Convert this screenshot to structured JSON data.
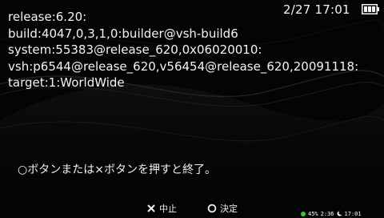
{
  "status_bar": {
    "clock": "2/27 17:01",
    "battery_icon": "battery-full-icon"
  },
  "system_info": {
    "lines": [
      "release:6.20:",
      "build:4047,0,3,1,0:builder@vsh-build6",
      "system:55383@release_620,0x06020010:",
      "vsh:p6544@release_620,v56454@release_620,20091118:",
      "target:1:WorldWide"
    ]
  },
  "message": "○ボタンまたは×ボタンを押すと終了。",
  "buttons": {
    "cancel": {
      "icon": "cross-button-icon",
      "label": "中止"
    },
    "confirm": {
      "icon": "circle-button-icon",
      "label": "決定"
    }
  },
  "mini_status": {
    "battery_percent": "45%",
    "battery_time": "2:36",
    "clock": "17:01",
    "colors": {
      "indicator": "#27d427"
    }
  },
  "colors": {
    "background": "#040404",
    "text": "#f2f2f2"
  }
}
